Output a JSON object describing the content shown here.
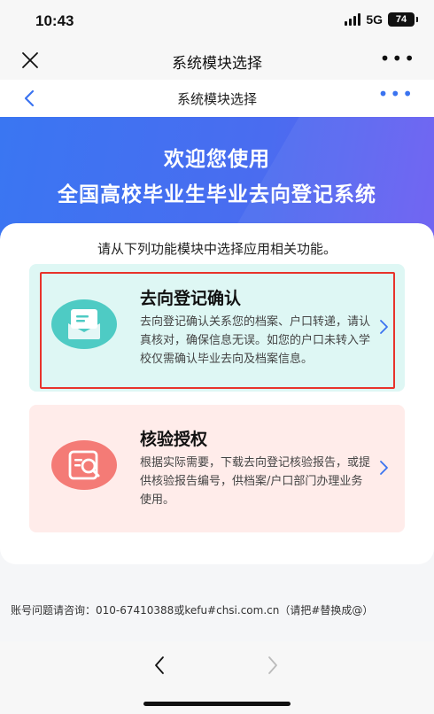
{
  "status_bar": {
    "time": "10:43",
    "network": "5G",
    "battery": "74"
  },
  "app_nav": {
    "title": "系统模块选择",
    "close_icon": "close-icon",
    "more_icon": "more-icon"
  },
  "page_header": {
    "title": "系统模块选择",
    "back_icon": "chevron-left-icon",
    "more_icon": "more-icon",
    "accent_color": "#3a73f0"
  },
  "banner": {
    "line1": "欢迎您使用",
    "line2": "全国高校毕业生毕业去向登记系统",
    "gradient": [
      "#3a76f2",
      "#6a5cf2"
    ]
  },
  "main": {
    "intro": "请从下列功能模块中选择应用相关功能。",
    "modules": [
      {
        "title": "去向登记确认",
        "description": "去向登记确认关系您的档案、户口转递，请认真核对，确保信息无误。如您的户口未转入学校仅需确认毕业去向及档案信息。",
        "icon": "envelope-document-icon",
        "background": "#def7f4",
        "icon_color": "#4ecbc4",
        "highlighted": true
      },
      {
        "title": "核验授权",
        "description": "根据实际需要，下载去向登记核验报告，或提供核验报告编号，供档案/户口部门办理业务使用。",
        "icon": "search-document-icon",
        "background": "#ffecea",
        "icon_color": "#f47b76",
        "highlighted": false
      }
    ]
  },
  "contact": "账号问题请咨询：010-67410388或kefu#chsi.com.cn（请把#替换成@）",
  "bottom_bar": {
    "back_icon": "chevron-left-icon",
    "forward_icon": "chevron-right-icon"
  }
}
